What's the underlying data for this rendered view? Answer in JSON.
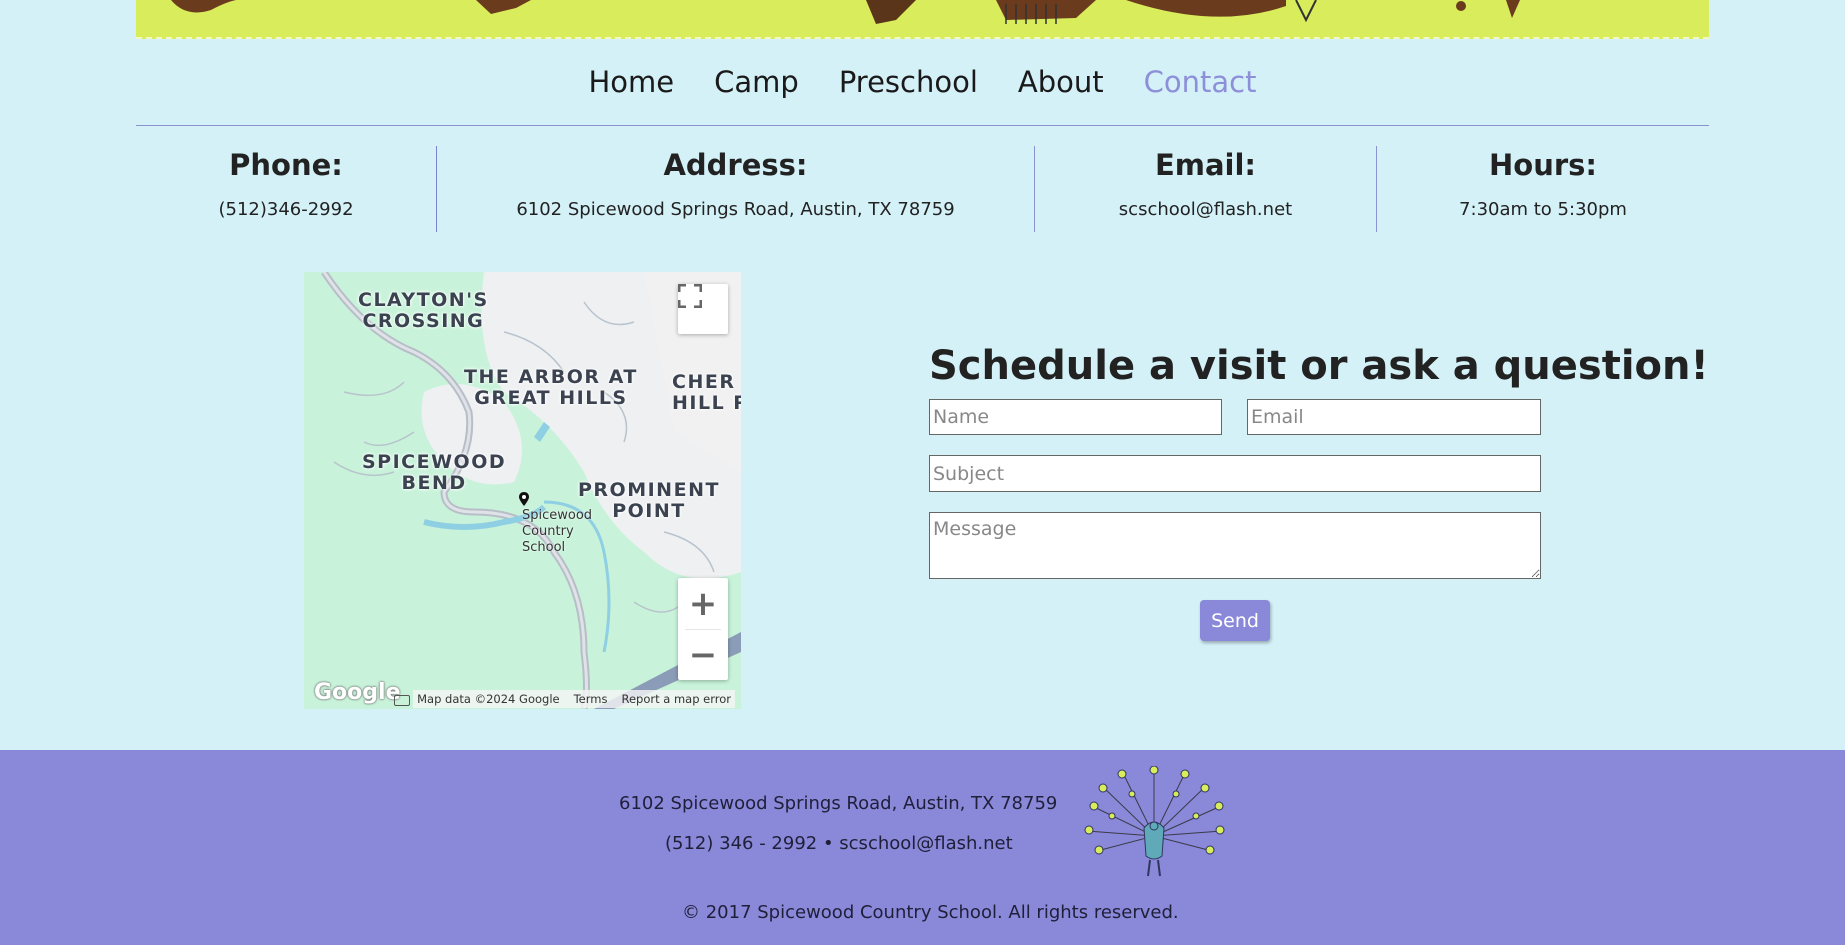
{
  "nav": {
    "items": [
      {
        "label": "Home"
      },
      {
        "label": "Camp"
      },
      {
        "label": "Preschool"
      },
      {
        "label": "About"
      },
      {
        "label": "Contact"
      }
    ]
  },
  "info": {
    "phone": {
      "heading": "Phone:",
      "value": "(512)346-2992"
    },
    "address": {
      "heading": "Address:",
      "value": "6102 Spicewood Springs Road, Austin, TX 78759"
    },
    "email": {
      "heading": "Email:",
      "value": "scschool@flash.net"
    },
    "hours": {
      "heading": "Hours:",
      "value": "7:30am to 5:30pm"
    }
  },
  "map": {
    "labels": {
      "claytons": "CLAYTON'S\nCROSSING",
      "arbor": "THE ARBOR AT\nGREAT HILLS",
      "cher": "CHER\nHILL P",
      "spicewood_bend": "SPICEWOOD\nBEND",
      "prominent": "PROMINENT\nPOINT"
    },
    "pin_label": "Spicewood\nCountry\nSchool",
    "logo": "Google",
    "data_text": "Map data ©2024 Google",
    "terms": "Terms",
    "report": "Report a map error",
    "zoom_in": "+",
    "zoom_out": "−"
  },
  "form": {
    "title": "Schedule a visit or ask a question!",
    "name_placeholder": "Name",
    "email_placeholder": "Email",
    "subject_placeholder": "Subject",
    "message_placeholder": "Message",
    "send_label": "Send"
  },
  "footer": {
    "address": "6102 Spicewood Springs Road, Austin, TX 78759",
    "contact": "(512) 346 - 2992 • scschool@flash.net",
    "copyright": "© 2017 Spicewood Country School. All rights reserved."
  },
  "colors": {
    "background": "#d4f1f8",
    "banner": "#d8ec5c",
    "accent": "#8a88d8",
    "nav_active": "#8d8fd8"
  }
}
